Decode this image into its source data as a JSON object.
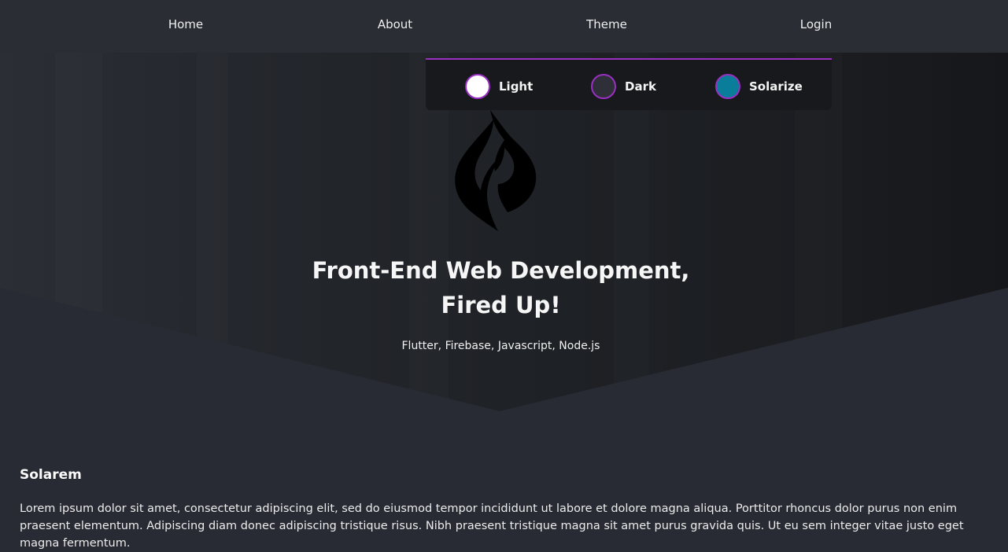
{
  "nav": {
    "items": [
      {
        "label": "Home"
      },
      {
        "label": "About"
      },
      {
        "label": "Theme"
      },
      {
        "label": "Login"
      }
    ]
  },
  "theme_menu": {
    "options": [
      {
        "label": "Light",
        "color": "#ffffff"
      },
      {
        "label": "Dark",
        "color": "#2e2f38"
      },
      {
        "label": "Solarize",
        "color": "#0a7d9a"
      }
    ],
    "accent": "#9a2fc2"
  },
  "hero": {
    "logo_icon": "flame-logo-icon",
    "title_line1": "Front-End Web Development,",
    "title_line2": "Fired Up!",
    "subtitle": "Flutter, Firebase, Javascript, Node.js"
  },
  "section": {
    "title": "Solarem",
    "body": "Lorem ipsum dolor sit amet, consectetur adipiscing elit, sed do eiusmod tempor incididunt ut labore et dolore magna aliqua. Porttitor rhoncus dolor purus non enim praesent elementum. Adipiscing diam donec adipiscing tristique risus. Nibh praesent tristique magna sit amet purus gravida quis. Ut eu sem integer vitae justo eget magna fermentum."
  },
  "colors": {
    "background": "#282b33",
    "navbar": "#2a2d34",
    "menu": "#17191c"
  }
}
